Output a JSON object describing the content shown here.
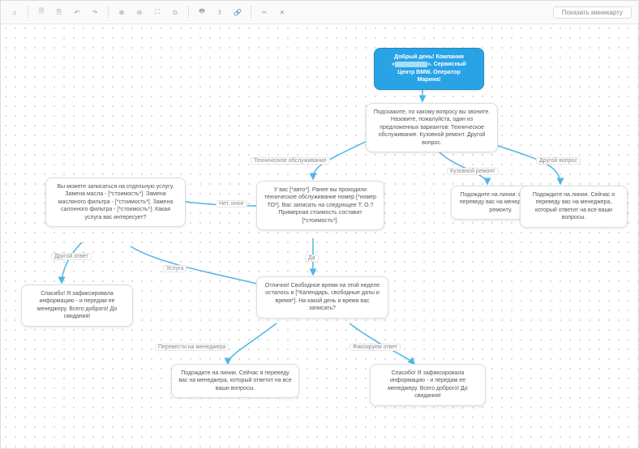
{
  "toolbar": {
    "minimap": "Показать миникарту",
    "icons": [
      "home",
      "new",
      "copy",
      "undo",
      "redo",
      "zoom-in",
      "zoom-out",
      "fit",
      "center",
      "divider",
      "print",
      "export",
      "link",
      "divider",
      "cut",
      "delete"
    ]
  },
  "nodes": {
    "start_l1": "Добрый день! Компания",
    "start_l2": "«",
    "start_l3": "». Сервисный",
    "start_l4": "Центр BMW. Оператор",
    "start_l5": "Марина!",
    "q1": "Подскажите, по какому вопросу вы звоните. Назовите, пожалуйста, один из предложенных вариантов: Техническое обслуживание. Кузовной ремонт. Другой вопрос.",
    "to": "У вас [*авто*]. Ранее вы проходили техническое обслуживание номер [*номер ТО*]. Вас записать на следующее Т. О.? Примерная стоимость составит [*стоимость*].",
    "body": "Подождите на линии. сейчас я переведу вас на менеджера по ремонту.",
    "other_q": "Подождите на линии. Сейчас я переведу вас на менеджера, который ответит на все ваши вопросы.",
    "services": "Вы можете записаться на отдельную услугу. Замена масла - [*стоимость*]. Замена масляного фильтра - [*стоимость*]. Замена салонного фильтра - [*стоимость*]. Какая услуга вас интересует?",
    "yes_to": "Отлично! Свободное время на этой неделе осталось в [*Календарь, свободные даты и время*]. На какой день и время вас записать?",
    "thanks1": "Спасибо! Я зафиксировала информацию  - и передам ее менеджеру. Всего доброго! До свидания!",
    "mgr": "Подождите на линии. Сейчас я переведу вас на менеджера, который ответит на все ваши вопросы.",
    "thanks2": "Спасибо! Я зафиксировала информацию  - и передам ее менеджеру. Всего доброго! До свидания!"
  },
  "labels": {
    "tech": "Техническое обслуживание",
    "body": "Кузовной ремонт",
    "other": "Другой вопрос",
    "no": "Нет, иное",
    "yes": "Да",
    "ans": "Другой ответ",
    "svc": "Услуга",
    "mgr": "Перевести на менеджера",
    "fix": "Фиксируем ответ"
  }
}
